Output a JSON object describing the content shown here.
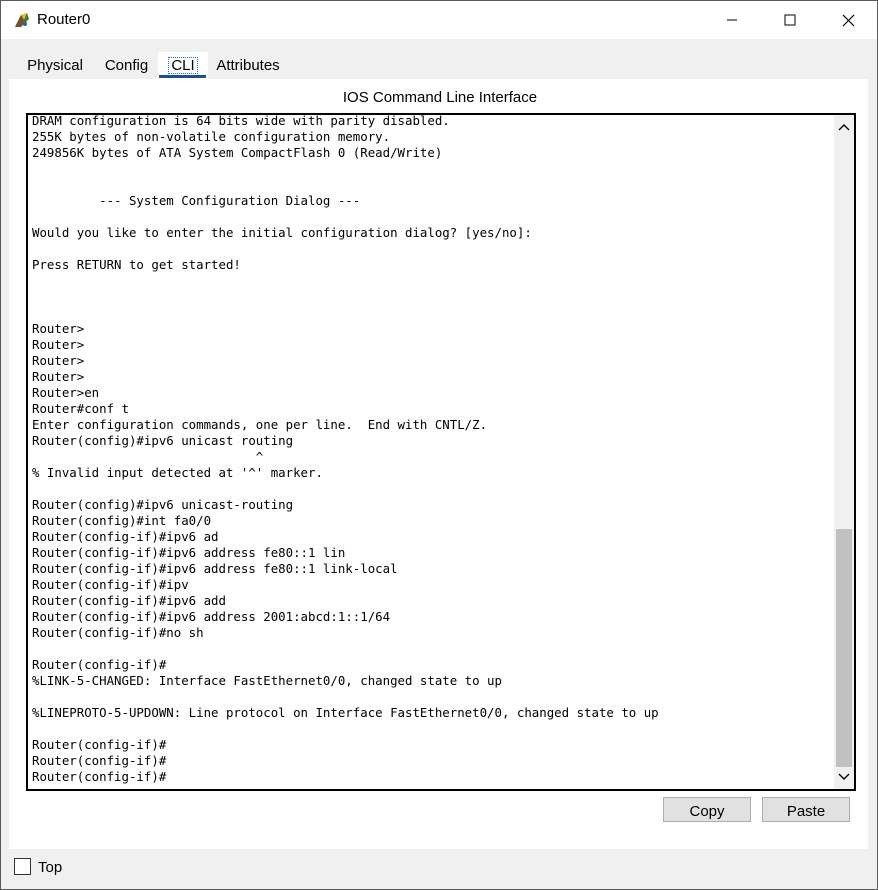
{
  "window": {
    "title": "Router0",
    "icon": "router-icon",
    "controls": {
      "minimize": "minimize-icon",
      "maximize": "maximize-icon",
      "close": "close-icon"
    }
  },
  "tabs": [
    {
      "label": "Physical",
      "active": false
    },
    {
      "label": "Config",
      "active": false
    },
    {
      "label": "CLI",
      "active": true
    },
    {
      "label": "Attributes",
      "active": false
    }
  ],
  "cli": {
    "heading": "IOS Command Line Interface",
    "console_lines": [
      "DRAM configuration is 64 bits wide with parity disabled.",
      "255K bytes of non-volatile configuration memory.",
      "249856K bytes of ATA System CompactFlash 0 (Read/Write)",
      "",
      "",
      "         --- System Configuration Dialog ---",
      "",
      "Would you like to enter the initial configuration dialog? [yes/no]:",
      "",
      "Press RETURN to get started!",
      "",
      "",
      "",
      "Router>",
      "Router>",
      "Router>",
      "Router>",
      "Router>en",
      "Router#conf t",
      "Enter configuration commands, one per line.  End with CNTL/Z.",
      "Router(config)#ipv6 unicast routing",
      "                              ^",
      "% Invalid input detected at '^' marker.",
      "",
      "Router(config)#ipv6 unicast-routing",
      "Router(config)#int fa0/0",
      "Router(config-if)#ipv6 ad",
      "Router(config-if)#ipv6 address fe80::1 lin",
      "Router(config-if)#ipv6 address fe80::1 link-local",
      "Router(config-if)#ipv",
      "Router(config-if)#ipv6 add",
      "Router(config-if)#ipv6 address 2001:abcd:1::1/64",
      "Router(config-if)#no sh",
      "",
      "Router(config-if)#",
      "%LINK-5-CHANGED: Interface FastEthernet0/0, changed state to up",
      "",
      "%LINEPROTO-5-UPDOWN: Line protocol on Interface FastEthernet0/0, changed state to up",
      "",
      "Router(config-if)#",
      "Router(config-if)#",
      "Router(config-if)#"
    ],
    "scroll_icons": {
      "up": "chevron-up-icon",
      "down": "chevron-down-icon"
    },
    "copy_label": "Copy",
    "paste_label": "Paste"
  },
  "footer": {
    "top_label": "Top",
    "top_checked": false
  }
}
